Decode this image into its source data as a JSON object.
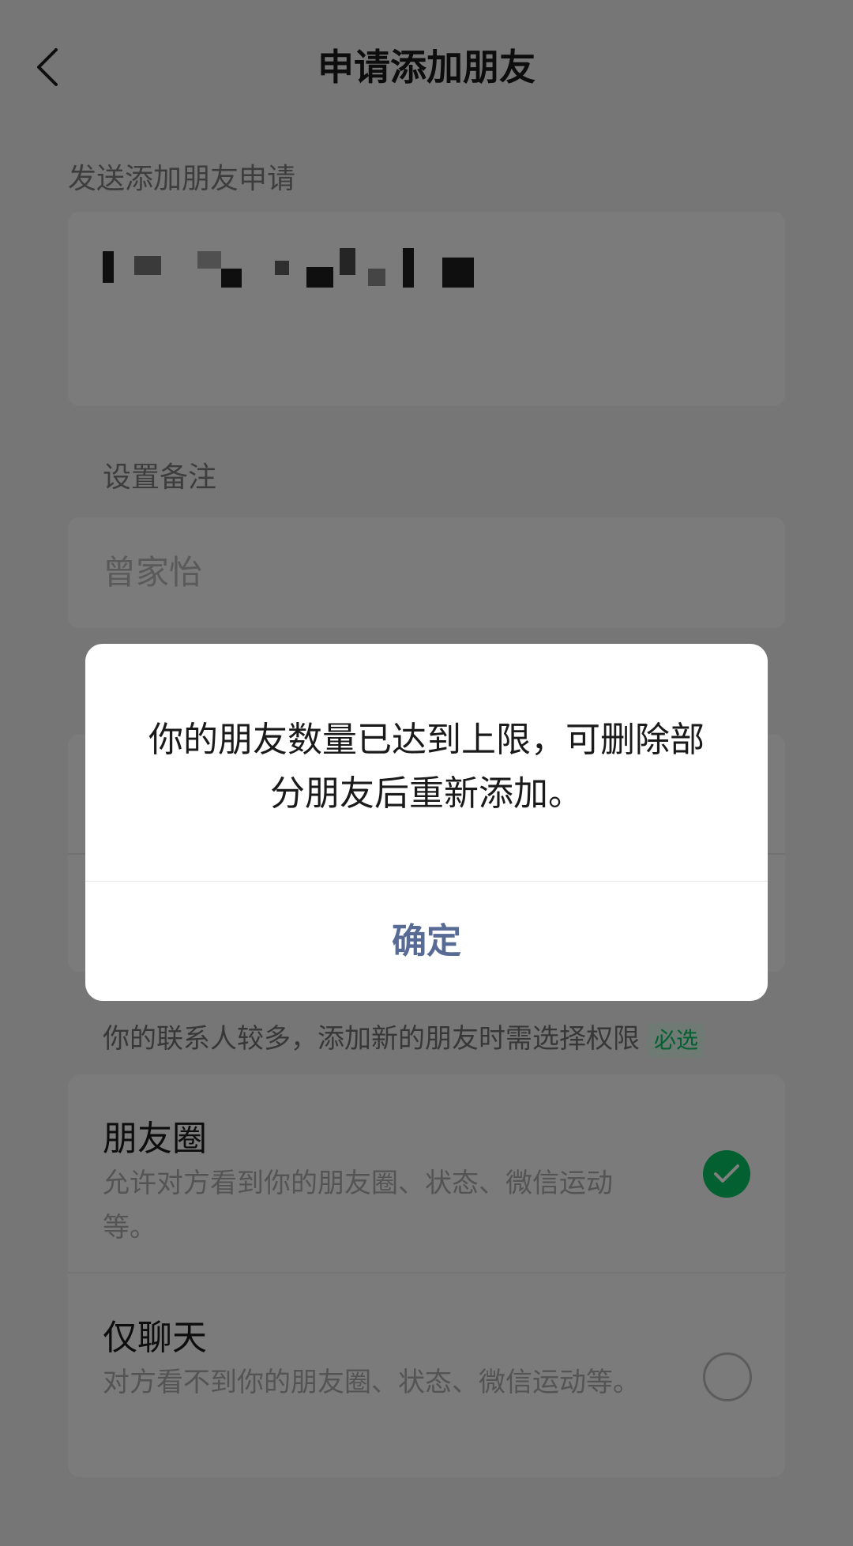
{
  "header": {
    "title": "申请添加朋友",
    "back_icon": "chevron-left-icon"
  },
  "request": {
    "label": "发送添加朋友申请"
  },
  "remark": {
    "label": "设置备注",
    "value": "曾家怡"
  },
  "permissions": {
    "hint": "你的联系人较多，添加新的朋友时需选择权限",
    "required_badge": "必选",
    "options": [
      {
        "title": "朋友圈",
        "description": "允许对方看到你的朋友圈、状态、微信运动等。",
        "selected": true
      },
      {
        "title": "仅聊天",
        "description": "对方看不到你的朋友圈、状态、微信运动等。",
        "selected": false
      }
    ]
  },
  "dialog": {
    "message": "你的朋友数量已达到上限，可删除部分朋友后重新添加。",
    "confirm_label": "确定"
  },
  "colors": {
    "accent_green": "#07c160",
    "dialog_button": "#576b95",
    "background": "#ededed"
  }
}
